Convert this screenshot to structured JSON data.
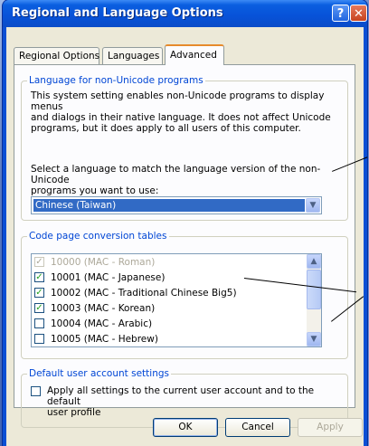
{
  "window": {
    "title": "Regional and Language Options"
  },
  "titlebar_buttons": {
    "help": "?",
    "close": "✕"
  },
  "tabs": [
    {
      "label": "Regional Options",
      "active": false
    },
    {
      "label": "Languages",
      "active": false
    },
    {
      "label": "Advanced",
      "active": true
    }
  ],
  "non_unicode": {
    "legend": "Language for non-Unicode programs",
    "description": [
      "This system setting enables non-Unicode programs to display menus",
      "and dialogs in their native language. It does not affect Unicode",
      "programs, but it does apply to all users of this computer."
    ],
    "prompt": [
      "Select a language to match the language version of the non-Unicode",
      "programs you want to use:"
    ],
    "selected_language": "Chinese (Taiwan)"
  },
  "code_pages": {
    "legend": "Code page conversion tables",
    "items": [
      {
        "label": "10000 (MAC - Roman)",
        "checked": true,
        "disabled": true
      },
      {
        "label": "10001 (MAC - Japanese)",
        "checked": true,
        "disabled": false
      },
      {
        "label": "10002 (MAC - Traditional Chinese Big5)",
        "checked": true,
        "disabled": false
      },
      {
        "label": "10003 (MAC - Korean)",
        "checked": true,
        "disabled": false
      },
      {
        "label": "10004 (MAC - Arabic)",
        "checked": false,
        "disabled": false
      },
      {
        "label": "10005 (MAC - Hebrew)",
        "checked": false,
        "disabled": false
      }
    ]
  },
  "default_user": {
    "legend": "Default user account settings",
    "checkbox_label": [
      "Apply all settings to the current user account and to the default",
      "user profile"
    ],
    "checked": false
  },
  "buttons": {
    "ok": "OK",
    "cancel": "Cancel",
    "apply": "Apply"
  },
  "colors": {
    "titlebar": "#0a5ee0",
    "selection": "#316ac5",
    "group_legend": "#0046d5"
  }
}
